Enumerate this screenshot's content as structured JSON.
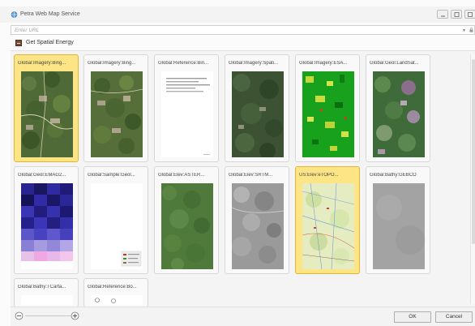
{
  "window": {
    "title": "Petra Web Map Service"
  },
  "url_bar": {
    "placeholder": "Enter URL"
  },
  "toolbar": {
    "spatial_label": "Get Spatial Energy"
  },
  "layers": [
    {
      "label": "Global:Imagery:Bing...",
      "selected": true,
      "thumb": "aerial"
    },
    {
      "label": "Global:Imagery:Bing...",
      "selected": false,
      "thumb": "aerial2"
    },
    {
      "label": "Global:Reference:Bin...",
      "selected": false,
      "thumb": "reference"
    },
    {
      "label": "Global:Imagery:Spati...",
      "selected": false,
      "thumb": "spatial"
    },
    {
      "label": "Global:Imagery:ESA...",
      "selected": false,
      "thumb": "esa"
    },
    {
      "label": "Global:Geol:LandSat...",
      "selected": false,
      "thumb": "landsat"
    },
    {
      "label": "Global:Geol:EMAG2...",
      "selected": false,
      "thumb": "emag"
    },
    {
      "label": "Global:Sample:Geol...",
      "selected": false,
      "thumb": "sample"
    },
    {
      "label": "Global:Elev:ASTER...",
      "selected": false,
      "thumb": "aster"
    },
    {
      "label": "Global:Elev:SRTM...",
      "selected": false,
      "thumb": "srtm"
    },
    {
      "label": "US:Elev:eTOPO...",
      "selected": true,
      "thumb": "topo"
    },
    {
      "label": "Global:Bathy:GEBCO",
      "selected": false,
      "thumb": "gebco"
    },
    {
      "label": "Global:Bathy:TCarta...",
      "selected": false,
      "thumb": "tcarta"
    },
    {
      "label": "Global:Reference:Bo...",
      "selected": false,
      "thumb": "reference2"
    }
  ],
  "buttons": {
    "ok": "OK",
    "cancel": "Cancel"
  }
}
